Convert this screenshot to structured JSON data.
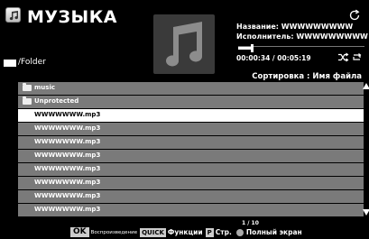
{
  "header": {
    "title": "МУЗЫКА",
    "path": "/Folder"
  },
  "info": {
    "title_line": "Название: WWWWWWWWW",
    "artist_line": "Исполнитель: WWWWWWWWW",
    "time": "00:00:34 / 00:05:19",
    "progress_fraction": 0.107
  },
  "sort_label": "Сортировка : Имя файла",
  "list": {
    "items": [
      {
        "label": "music",
        "type": "folder"
      },
      {
        "label": "Unprotected",
        "type": "folder"
      },
      {
        "label": "WWWWWWW.mp3",
        "type": "file",
        "selected": true
      },
      {
        "label": "WWWWWWW.mp3",
        "type": "file"
      },
      {
        "label": "WWWWWWW.mp3",
        "type": "file"
      },
      {
        "label": "WWWWWWW.mp3",
        "type": "file"
      },
      {
        "label": "WWWWWWW.mp3",
        "type": "file"
      },
      {
        "label": "WWWWWWW.mp3",
        "type": "file"
      },
      {
        "label": "WWWWWWW.mp3",
        "type": "file"
      },
      {
        "label": "WWWWWWW.mp3",
        "type": "file"
      }
    ],
    "page": "1 / 10"
  },
  "footer": {
    "ok_key": "OK",
    "ok_hint": "Воспроизведение",
    "quick_key": "QUICK",
    "quick_hint": "Функции",
    "p_key": "P",
    "p_hint": "Стр.",
    "green_hint": "Полный экран"
  },
  "icons": {
    "app": "music-app-icon",
    "refresh": "refresh-icon",
    "shuffle": "shuffle-icon",
    "repeat": "repeat-icon",
    "album": "music-note-icon"
  }
}
